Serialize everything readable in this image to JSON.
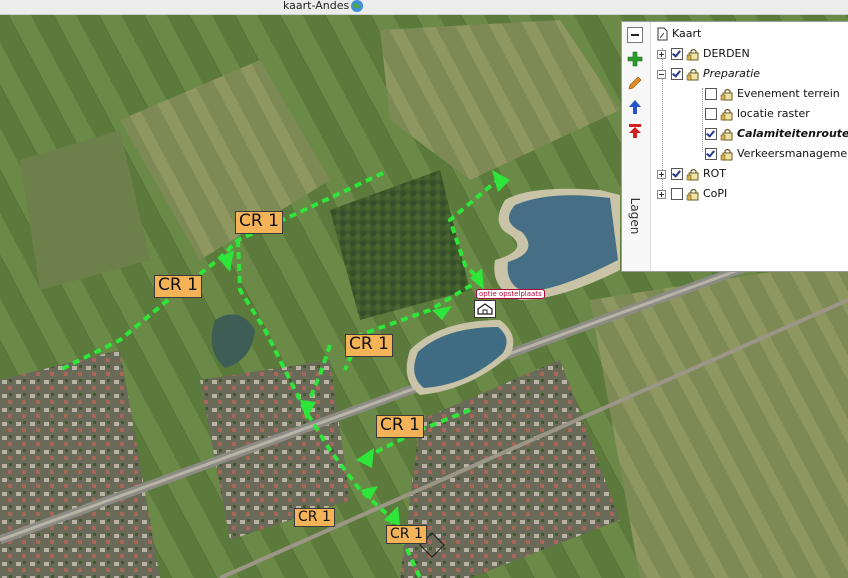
{
  "window": {
    "title": "kaart-Andes",
    "globe_icon": "globe-icon"
  },
  "map": {
    "type": "aerial-photo",
    "route_color": "#2ee53a",
    "route_labels": [
      {
        "text": "CR 1",
        "size": "big"
      },
      {
        "text": "CR 1",
        "size": "big"
      },
      {
        "text": "CR 1",
        "size": "big"
      },
      {
        "text": "CR 1",
        "size": "big"
      },
      {
        "text": "CR 1",
        "size": "small"
      },
      {
        "text": "CR 1",
        "size": "small"
      }
    ],
    "poi": {
      "label": "optie opstelplaats",
      "icon": "house-icon"
    }
  },
  "layers_panel": {
    "vertical_tab": "Lagen",
    "toolbar": [
      {
        "icon": "minus-icon"
      },
      {
        "icon": "plus-icon",
        "color": "#2e9b2e"
      },
      {
        "icon": "pencil-icon",
        "color": "#e08a1e"
      },
      {
        "icon": "arrow-up-icon",
        "color": "#2653c9"
      },
      {
        "icon": "remove-top-icon",
        "color": "#d22020"
      }
    ],
    "root": {
      "label": "Kaart",
      "icon": "page-icon"
    },
    "items": [
      {
        "label": "DERDEN",
        "checked": true,
        "expander": "plus",
        "indent": 0,
        "style": "normal"
      },
      {
        "label": "Preparatie",
        "checked": true,
        "expander": "minus",
        "indent": 0,
        "style": "italic"
      },
      {
        "label": "Evenement terrein",
        "checked": false,
        "expander": "none",
        "indent": 1,
        "style": "normal"
      },
      {
        "label": "locatie raster",
        "checked": false,
        "expander": "none",
        "indent": 1,
        "style": "normal"
      },
      {
        "label": "Calamiteitenroute",
        "checked": true,
        "expander": "none",
        "indent": 1,
        "style": "bold-italic"
      },
      {
        "label": "Verkeersmanagement",
        "checked": true,
        "expander": "none",
        "indent": 1,
        "style": "normal"
      },
      {
        "label": "ROT",
        "checked": true,
        "expander": "plus",
        "indent": 0,
        "style": "normal"
      },
      {
        "label": "CoPI",
        "checked": false,
        "expander": "plus",
        "indent": 0,
        "style": "normal"
      }
    ]
  }
}
